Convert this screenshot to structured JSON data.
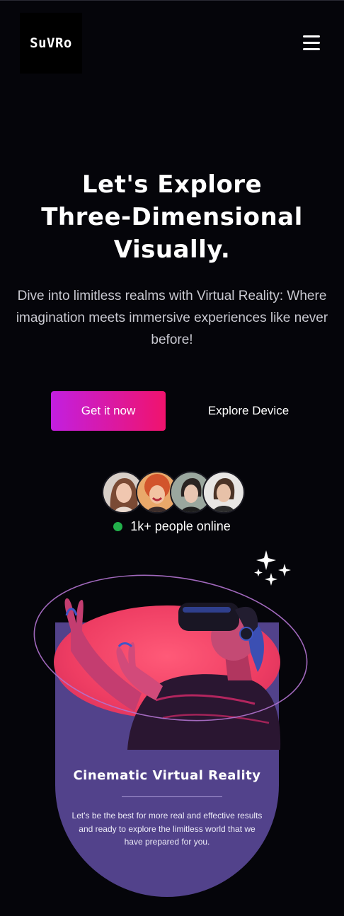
{
  "header": {
    "logo": "SuVRo",
    "menu_icon": "hamburger-menu-icon"
  },
  "hero": {
    "title_lines": [
      "Let's Explore",
      "Three-Dimensional",
      "Visually."
    ],
    "description": "Dive into limitless realms with Virtual Reality: Where imagination meets immersive experiences like never before!",
    "primary_button": "Get it now",
    "secondary_button": "Explore Device"
  },
  "community": {
    "avatars": [
      "avatar-woman-1",
      "avatar-woman-2",
      "avatar-woman-3",
      "avatar-woman-4"
    ],
    "status_color": "#22b04b",
    "online_text": "1k+ people online"
  },
  "showcase": {
    "sparkle_icon": "sparkles-icon",
    "image": "vr-headset-person",
    "title": "Cinematic Virtual Reality",
    "body": "Let's be the best for more real and effective results and ready to explore the limitless world that we have prepared for you."
  },
  "colors": {
    "background": "#05050a",
    "accent_start": "#c21fe0",
    "accent_end": "#f0136d",
    "card": "#52428b",
    "disc": "#ee3d63"
  }
}
